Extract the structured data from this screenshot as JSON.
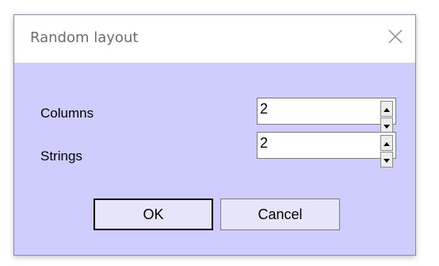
{
  "dialog": {
    "title": "Random layout",
    "close_icon": "close-icon"
  },
  "fields": [
    {
      "label": "Columns",
      "value": "2"
    },
    {
      "label": "Strings",
      "value": "2"
    }
  ],
  "buttons": {
    "ok_label": "OK",
    "cancel_label": "Cancel"
  },
  "colors": {
    "dialog_background": "#cfcdfd",
    "titlebar_background": "#ffffff",
    "title_text": "#6d6d6d"
  }
}
